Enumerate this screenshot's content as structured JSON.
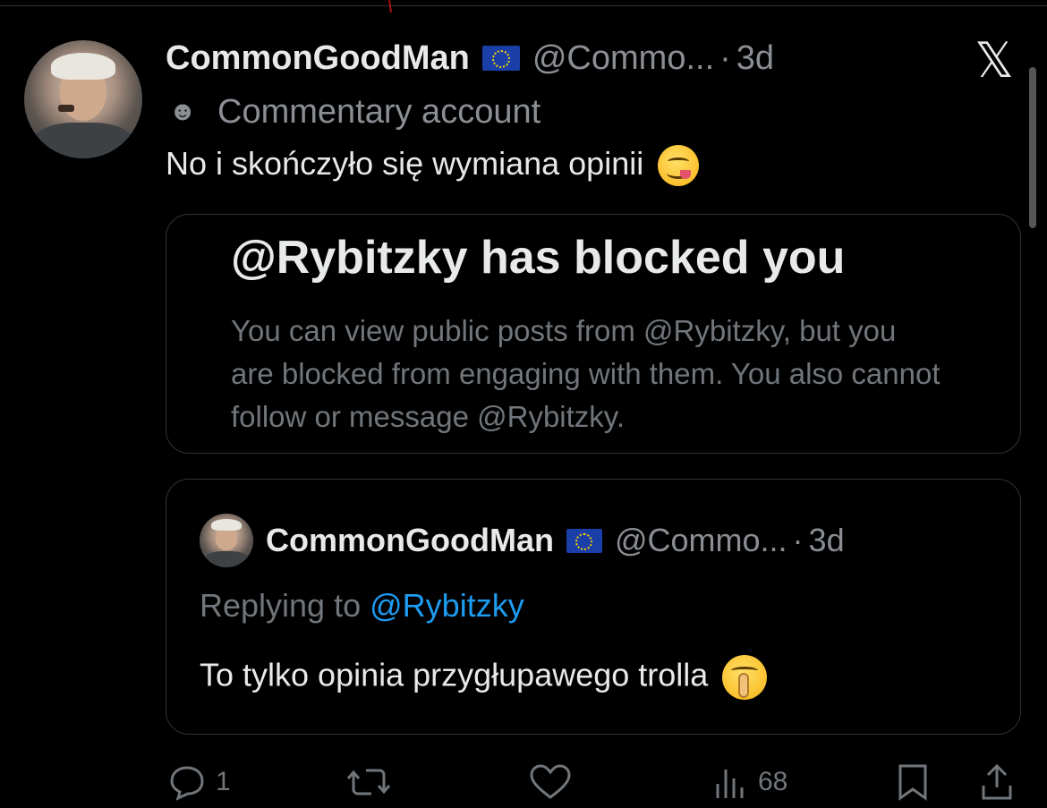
{
  "tweet": {
    "display_name": "CommonGoodMan",
    "handle": "@Commo...",
    "separator": "·",
    "time": "3d",
    "account_label": "Commentary account",
    "text": "No i skończyło się wymiana opinii"
  },
  "blocked_notice": {
    "title": "@Rybitzky has blocked you",
    "body": "You can view public posts from @Rybitzky, but you are blocked from engaging with them. You also cannot follow or message @Rybitzky."
  },
  "quoted_tweet": {
    "display_name": "CommonGoodMan",
    "handle": "@Commo...",
    "separator": "·",
    "time": "3d",
    "replying_prefix": "Replying to",
    "replying_to": "@Rybitzky",
    "text": "To tylko opinia przygłupawego trolla"
  },
  "actions": {
    "replies": "1",
    "views": "68"
  },
  "icons": {
    "close": "x-logo-icon",
    "label": "theater-mask-icon",
    "flag": "eu-flag-icon"
  },
  "colors": {
    "background": "#000000",
    "text": "#e7e9ea",
    "muted": "#71767b",
    "link": "#1d9bf0",
    "border": "#2f3336"
  }
}
